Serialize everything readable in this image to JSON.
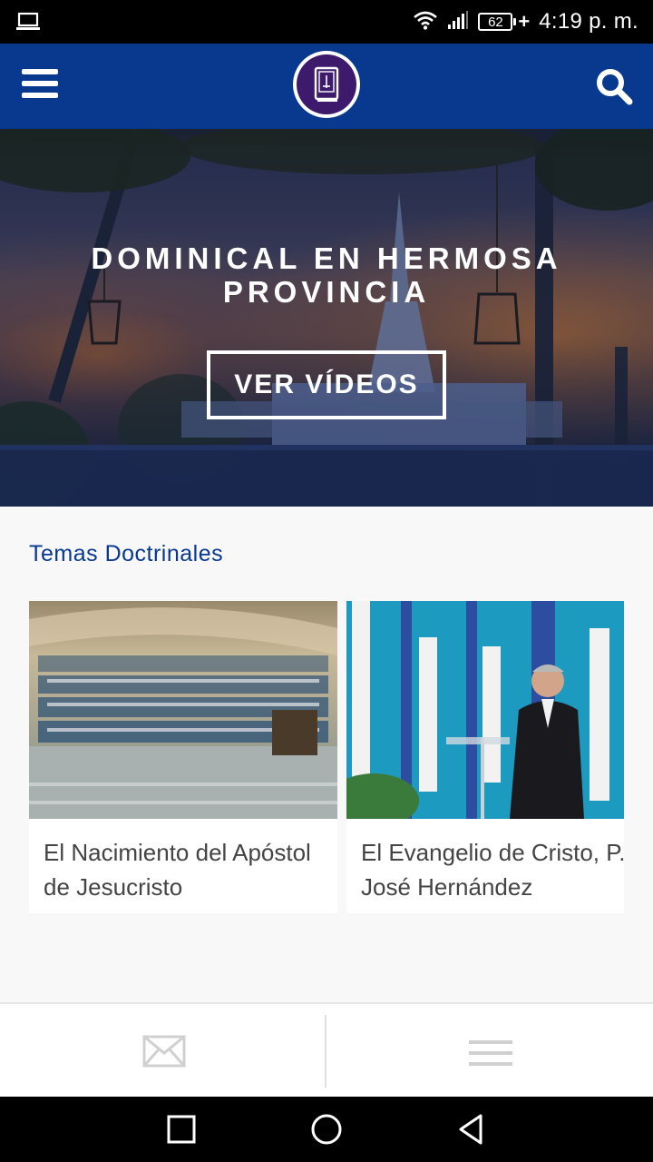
{
  "status_bar": {
    "battery_level": "62",
    "time": "4:19 p. m."
  },
  "header": {
    "logo_name": "book-logo"
  },
  "hero": {
    "title_line1": "DOMINICAL EN HERMOSA",
    "title_line2": "PROVINCIA",
    "button_label": "VER VÍDEOS"
  },
  "section": {
    "title": "Temas Doctrinales",
    "cards": [
      {
        "title_line1": "El Nacimiento del Apóstol",
        "title_line2": "de Jesucristo"
      },
      {
        "title_line1": "El Evangelio de Cristo, P.B",
        "title_line2": "José Hernández"
      }
    ]
  },
  "colors": {
    "brand_blue": "#08398f",
    "logo_purple": "#3d1a6b",
    "card_text": "#444444"
  }
}
